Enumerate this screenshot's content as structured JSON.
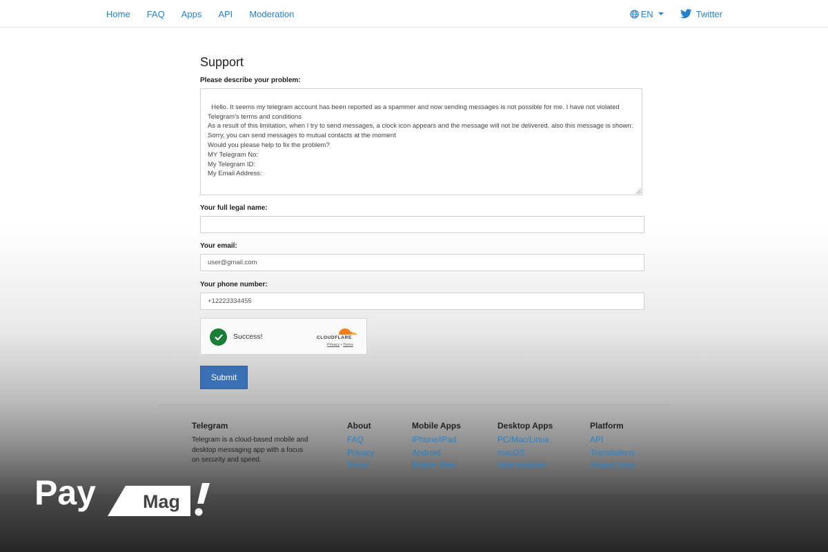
{
  "nav": {
    "links": [
      "Home",
      "FAQ",
      "Apps",
      "API",
      "Moderation"
    ],
    "language": "EN",
    "twitter": "Twitter"
  },
  "form": {
    "title": "Support",
    "problem_label": "Please describe your problem:",
    "problem_text": "Hello. It seems my telegram account has been reported as a spammer and now sending messages is not possible for me. I have not violated Telegram's terms and conditions\nAs a result of this limitation, when I try to send messages, a clock icon appears and the message will not be delivered. also this message is shown: Sorry, you can send messages to mutual contacts at the moment\nWould you please help to fix the problem?\nMY Telegram No:\nMy Telegram ID:\nMy Email Address:",
    "name_label": "Your full legal name:",
    "name_value": "",
    "email_label": "Your email:",
    "email_placeholder": "user@gmail.com",
    "phone_label": "Your phone number:",
    "phone_placeholder": "+12223334455",
    "captcha": {
      "status": "Success!",
      "brand": "CLOUDFLARE",
      "privacy": "Privacy",
      "separator": "•",
      "terms": "Terms"
    },
    "submit_label": "Submit"
  },
  "footer": {
    "about_telegram": {
      "title": "Telegram",
      "text": "Telegram is a cloud-based mobile and desktop messaging app with a focus on security and speed."
    },
    "columns": [
      {
        "title": "About",
        "links": [
          "FAQ",
          "Privacy",
          "Press"
        ]
      },
      {
        "title": "Mobile Apps",
        "links": [
          "iPhone/iPad",
          "Android",
          "Mobile Web"
        ]
      },
      {
        "title": "Desktop Apps",
        "links": [
          "PC/Mac/Linux",
          "macOS",
          "Web-browser"
        ]
      },
      {
        "title": "Platform",
        "links": [
          "API",
          "Translations",
          "Instant View"
        ]
      }
    ]
  },
  "watermark": {
    "word1": "Pay",
    "word2": "Mag"
  },
  "colors": {
    "link": "#2481cc",
    "submit": "#3a6fb3",
    "success": "#1a7f36",
    "cloudflare": "#f38020"
  }
}
